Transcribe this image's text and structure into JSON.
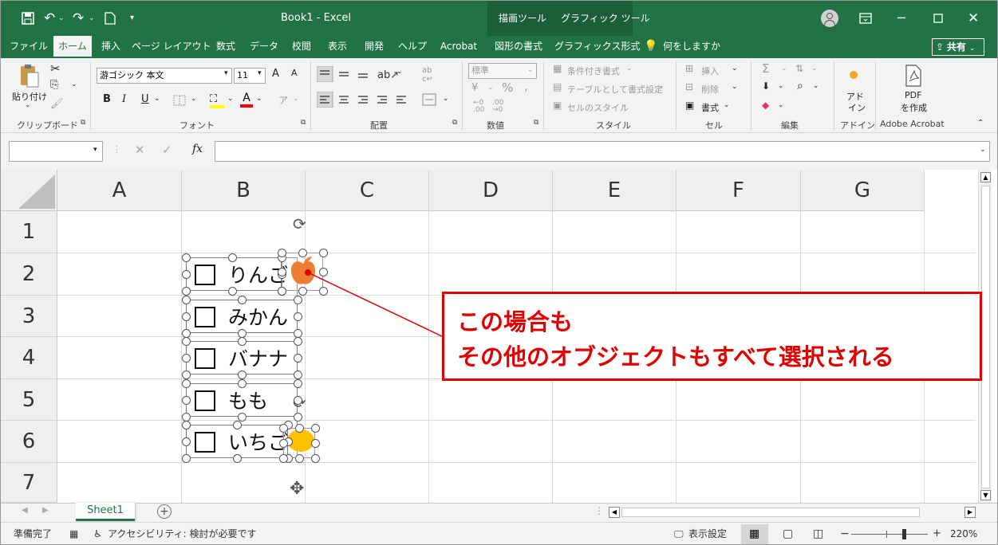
{
  "titlebar": {
    "doc_title": "Book1  -  Excel",
    "context_tab_drawing": "描画ツール",
    "context_tab_graphics": "グラフィック ツール"
  },
  "tabs": [
    "ファイル",
    "ホーム",
    "挿入",
    "ページ レイアウト",
    "数式",
    "データ",
    "校閲",
    "表示",
    "開発",
    "ヘルプ",
    "Acrobat",
    "図形の書式",
    "グラフィックス形式"
  ],
  "tell_me": "何をしますか",
  "share_label": "共有",
  "ribbon": {
    "clipboard": {
      "paste": "貼り付け",
      "group": "クリップボード"
    },
    "font": {
      "name": "游ゴシック 本文",
      "size": "11",
      "bold": "B",
      "italic": "I",
      "underline": "U",
      "grow": "A",
      "shrink": "A",
      "group": "フォント"
    },
    "alignment": {
      "group": "配置"
    },
    "number": {
      "format": "標準",
      "percent": "%",
      "comma": ",",
      "group": "数値"
    },
    "styles": {
      "conditional": "条件付き書式",
      "table": "テーブルとして書式設定",
      "cell": "セルのスタイル",
      "group": "スタイル"
    },
    "cells": {
      "insert": "挿入",
      "delete": "削除",
      "format": "書式",
      "group": "セル"
    },
    "editing": {
      "group": "編集"
    },
    "addins": {
      "label1": "アド",
      "label2": "イン",
      "group": "アドイン"
    },
    "acrobat": {
      "label1": "PDF",
      "label2": "を作成",
      "group": "Adobe Acrobat"
    }
  },
  "formula_bar": {
    "name_box": "",
    "fx": "fx",
    "formula": ""
  },
  "columns": [
    "A",
    "B",
    "C",
    "D",
    "E",
    "F",
    "G"
  ],
  "rows": [
    "1",
    "2",
    "3",
    "4",
    "5",
    "6",
    "7"
  ],
  "checkboxes": [
    {
      "label": "りんご"
    },
    {
      "label": "みかん"
    },
    {
      "label": "バナナ"
    },
    {
      "label": "もも"
    },
    {
      "label": "いちご"
    }
  ],
  "callout": {
    "line1": "この場合も",
    "line2": "その他のオブジェクトもすべて選択される"
  },
  "sheet_tab": "Sheet1",
  "status": {
    "ready": "準備完了",
    "accessibility": "アクセシビリティ: 検討が必要です",
    "display_settings": "表示設定",
    "zoom": "220%"
  },
  "colors": {
    "excel_green": "#217346",
    "callout_red": "#e00000",
    "apple_orange": "#ed7d31",
    "lemon_yellow": "#ffc000"
  }
}
